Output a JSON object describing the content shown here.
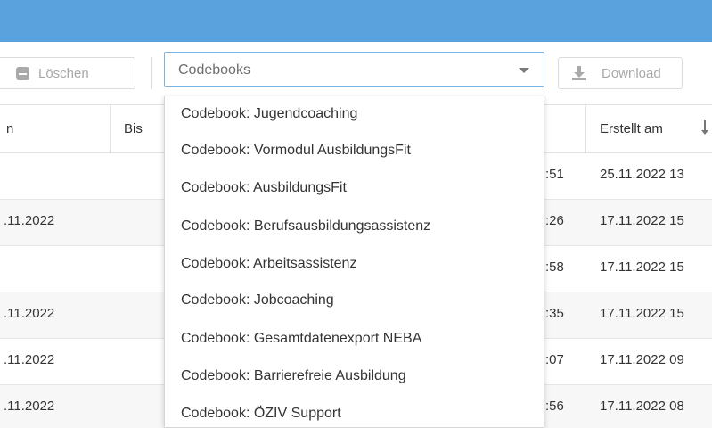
{
  "toolbar": {
    "delete_label": "Löschen",
    "select_value": "Codebooks",
    "download_label": "Download"
  },
  "table": {
    "headers": {
      "von": "n",
      "bis": "Bis",
      "erstellt_am": "Erstellt am"
    },
    "rows": [
      {
        "von": "",
        "time": ":51",
        "erstellt_am": "25.11.2022 13"
      },
      {
        "von": ".11.2022",
        "time": ":26",
        "erstellt_am": "17.11.2022 15"
      },
      {
        "von": "",
        "time": ":58",
        "erstellt_am": "17.11.2022 15"
      },
      {
        "von": ".11.2022",
        "time": ":35",
        "erstellt_am": "17.11.2022 15"
      },
      {
        "von": ".11.2022",
        "time": ":07",
        "erstellt_am": "17.11.2022 09"
      },
      {
        "von": ".11.2022",
        "time": ":56",
        "erstellt_am": "17.11.2022 08"
      }
    ]
  },
  "dropdown": {
    "options": [
      "Codebook: Jugendcoaching",
      "Codebook: Vormodul AusbildungsFit",
      "Codebook: AusbildungsFit",
      "Codebook: Berufsausbildungsassistenz",
      "Codebook: Arbeitsassistenz",
      "Codebook: Jobcoaching",
      "Codebook: Gesamtdatenexport NEBA",
      "Codebook: Barrierefreie Ausbildung",
      "Codebook: ÖZIV Support"
    ]
  },
  "colors": {
    "topbar": "#5aa2dd",
    "select_border": "#7cb3e2",
    "row_alt": "#f7f7f7"
  },
  "icons": [
    "minus-square-icon",
    "chevron-down-icon",
    "download-icon",
    "sort-descending-icon"
  ]
}
